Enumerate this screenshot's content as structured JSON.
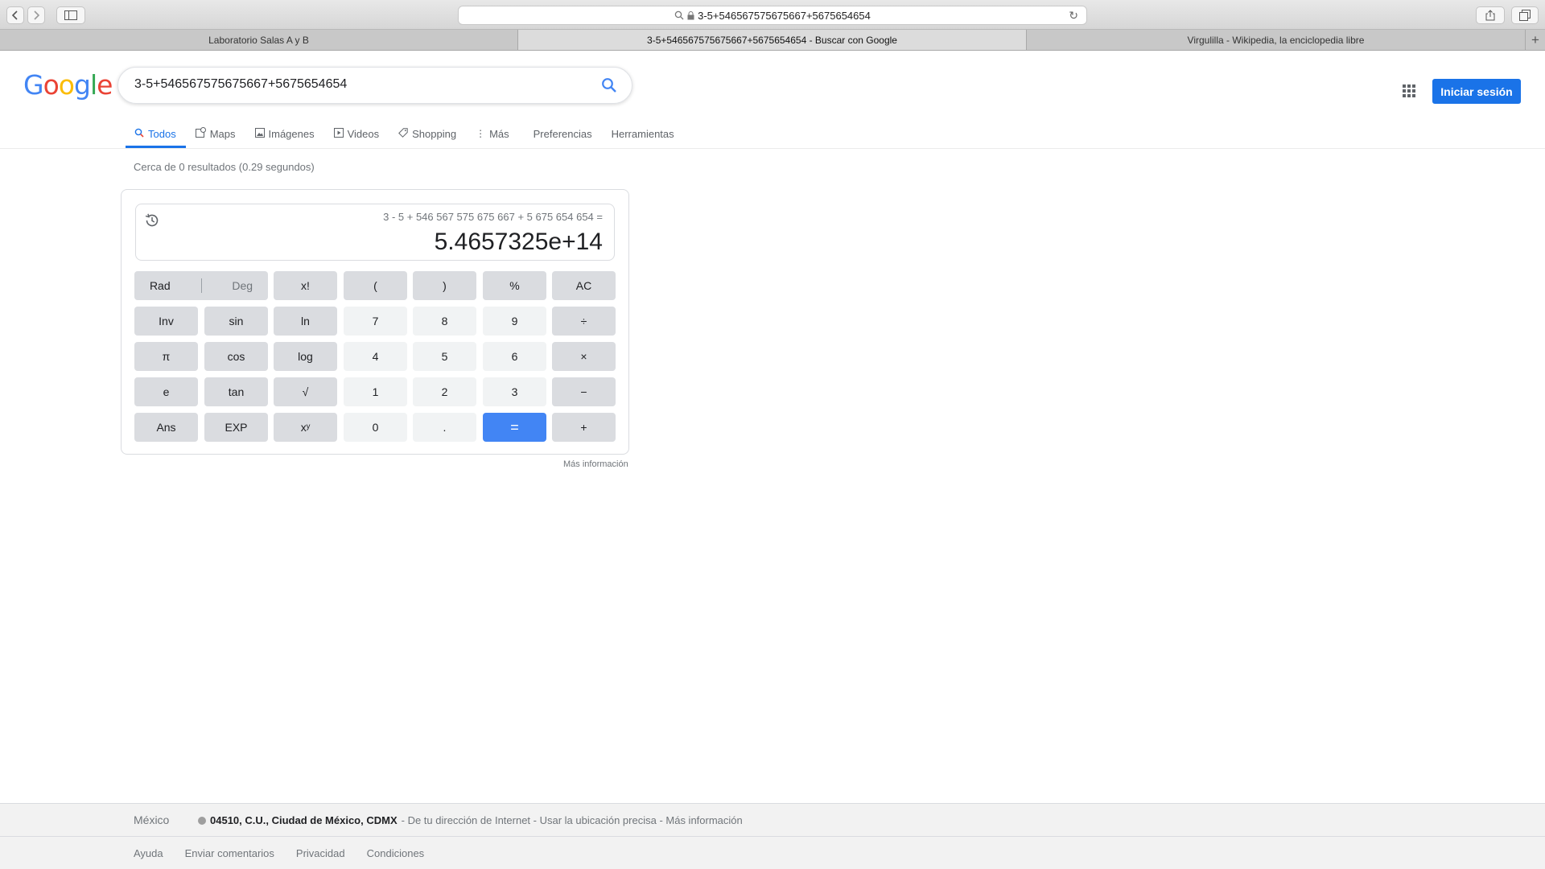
{
  "browser": {
    "address": "3-5+546567575675667+5675654654",
    "tabs": [
      {
        "title": "Laboratorio Salas A y B",
        "active": false
      },
      {
        "title": "3-5+546567575675667+5675654654 - Buscar con Google",
        "active": true
      },
      {
        "title": "Virgulilla - Wikipedia, la enciclopedia libre",
        "active": false
      }
    ]
  },
  "google": {
    "logo": "Google",
    "query": "3-5+546567575675667+5675654654",
    "signin_label": "Iniciar sesión",
    "nav": [
      "Todos",
      "Maps",
      "Imágenes",
      "Videos",
      "Shopping",
      "Más",
      "Preferencias",
      "Herramientas"
    ],
    "stats": "Cerca de 0 resultados (0.29 segundos)"
  },
  "calculator": {
    "expression": "3 - 5 + 546 567 575 675 667 + 5 675 654 654 =",
    "result": "5.4657325e+14",
    "rad": "Rad",
    "deg": "Deg",
    "keys": {
      "fact": "x!",
      "lparen": "(",
      "rparen": ")",
      "percent": "%",
      "ac": "AC",
      "inv": "Inv",
      "sin": "sin",
      "ln": "ln",
      "k7": "7",
      "k8": "8",
      "k9": "9",
      "div": "÷",
      "pi": "π",
      "cos": "cos",
      "log": "log",
      "k4": "4",
      "k5": "5",
      "k6": "6",
      "mul": "×",
      "e": "e",
      "tan": "tan",
      "sqrt": "√",
      "k1": "1",
      "k2": "2",
      "k3": "3",
      "sub": "−",
      "ans": "Ans",
      "exp": "EXP",
      "pow": "xʸ",
      "k0": "0",
      "dot": ".",
      "eq": "=",
      "add": "+"
    },
    "more_info": "Más información"
  },
  "footer": {
    "country": "México",
    "location_bold": "04510, C.U., Ciudad de México, CDMX",
    "location_rest": "- De tu dirección de Internet - Usar la ubicación precisa - Más información",
    "links": [
      "Ayuda",
      "Enviar comentarios",
      "Privacidad",
      "Condiciones"
    ]
  },
  "colors": {
    "google_blue": "#1a73e8",
    "equals_blue": "#4285f4"
  }
}
